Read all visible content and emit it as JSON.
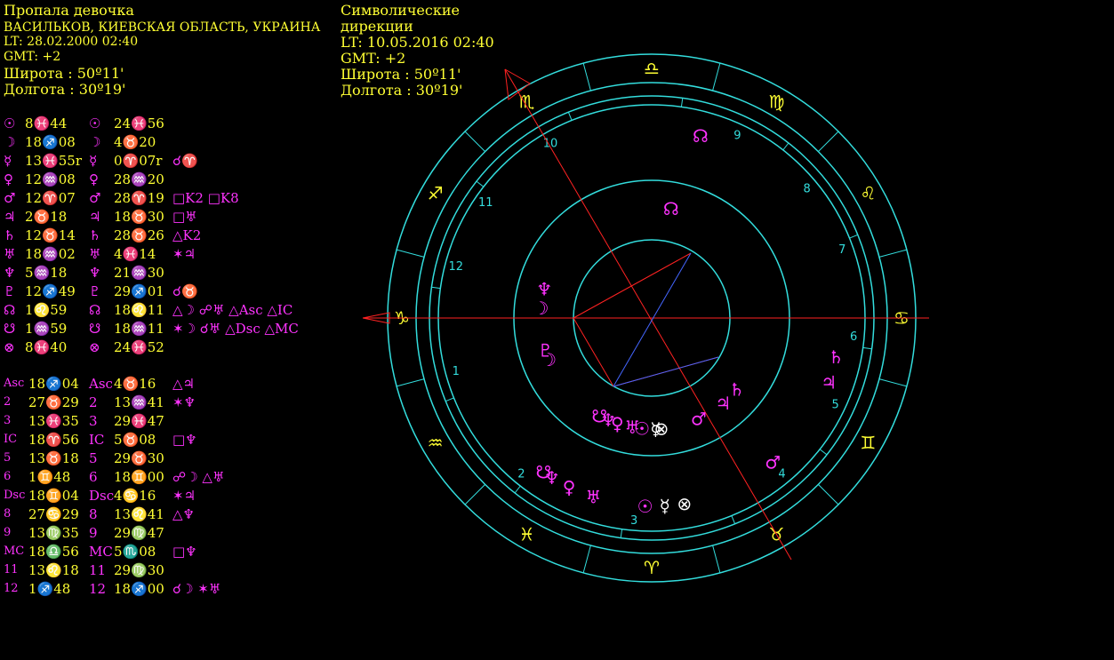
{
  "natal": {
    "title": "Пропала девочка",
    "place": "ВАСИЛЬКОВ, КИЕВСКАЯ ОБЛАСТЬ, УКРАИНА",
    "lt": "LT: 28.02.2000  02:40",
    "gmt": "GMT: +2",
    "lat": "Широта :      50º11'",
    "lon": "Долгота :      30º19'"
  },
  "directions": {
    "title_line1": "Символические",
    "title_line2": "дирекции",
    "lt": "LT: 10.05.2016  02:40",
    "gmt": "GMT: +2",
    "lat": "Широта :       50º11'",
    "lon": "Долгота :      30º19'"
  },
  "planets": [
    {
      "sym": "☉",
      "natal": "8♓44",
      "dsym": "☉",
      "dir": "24♓56",
      "aspects": ""
    },
    {
      "sym": "☽",
      "natal": "18♐08",
      "dsym": "☽",
      "dir": "4♉20",
      "aspects": ""
    },
    {
      "sym": "☿",
      "natal": "13♓55r",
      "dsym": "☿",
      "dir": "0♈07r",
      "aspects": "☌♈"
    },
    {
      "sym": "♀",
      "natal": "12♒08",
      "dsym": "♀",
      "dir": "28♒20",
      "aspects": ""
    },
    {
      "sym": "♂",
      "natal": "12♈07",
      "dsym": "♂",
      "dir": "28♈19",
      "aspects": "□K2 □K8"
    },
    {
      "sym": "♃",
      "natal": "2♉18",
      "dsym": "♃",
      "dir": "18♉30",
      "aspects": "□♅"
    },
    {
      "sym": "♄",
      "natal": "12♉14",
      "dsym": "♄",
      "dir": "28♉26",
      "aspects": "△K2"
    },
    {
      "sym": "♅",
      "natal": "18♒02",
      "dsym": "♅",
      "dir": "4♓14",
      "aspects": "✶♃"
    },
    {
      "sym": "♆",
      "natal": "5♒18",
      "dsym": "♆",
      "dir": "21♒30",
      "aspects": ""
    },
    {
      "sym": "♇",
      "natal": "12♐49",
      "dsym": "♇",
      "dir": "29♐01",
      "aspects": "☌♉"
    },
    {
      "sym": "☊",
      "natal": "1♌59",
      "dsym": "☊",
      "dir": "18♌11",
      "aspects": "△☽ ☍♅ △Asc △IC"
    },
    {
      "sym": "☋",
      "natal": "1♒59",
      "dsym": "☋",
      "dir": "18♒11",
      "aspects": "✶☽ ☌♅ △Dsc △MC"
    },
    {
      "sym": "⊗",
      "natal": "8♓40",
      "dsym": "⊗",
      "dir": "24♓52",
      "aspects": ""
    }
  ],
  "houses": [
    {
      "label": "Asc",
      "natal": "18♐04",
      "dlabel": "Asc",
      "dir": "4♉16",
      "aspects": "△♃"
    },
    {
      "label": "2",
      "natal": "27♉29",
      "dlabel": "2",
      "dir": "13♒41",
      "aspects": "✶♆"
    },
    {
      "label": "3",
      "natal": "13♓35",
      "dlabel": "3",
      "dir": "29♓47",
      "aspects": ""
    },
    {
      "label": "IC",
      "natal": "18♈56",
      "dlabel": "IC",
      "dir": "5♉08",
      "aspects": "□♆"
    },
    {
      "label": "5",
      "natal": "13♉18",
      "dlabel": "5",
      "dir": "29♉30",
      "aspects": ""
    },
    {
      "label": "6",
      "natal": "1♊48",
      "dlabel": "6",
      "dir": "18♊00",
      "aspects": "☍☽ △♅"
    },
    {
      "label": "Dsc",
      "natal": "18♊04",
      "dlabel": "Dsc",
      "dir": "4♋16",
      "aspects": "✶♃"
    },
    {
      "label": "8",
      "natal": "27♋29",
      "dlabel": "8",
      "dir": "13♌41",
      "aspects": "△♆"
    },
    {
      "label": "9",
      "natal": "13♍35",
      "dlabel": "9",
      "dir": "29♍47",
      "aspects": ""
    },
    {
      "label": "MC",
      "natal": "18♎56",
      "dlabel": "MC",
      "dir": "5♏08",
      "aspects": "□♆"
    },
    {
      "label": "11",
      "natal": "13♌18",
      "dlabel": "11",
      "dir": "29♍30",
      "aspects": ""
    },
    {
      "label": "12",
      "natal": "1♐48",
      "dlabel": "12",
      "dir": "18♐00",
      "aspects": "☌☽ ✶♅"
    }
  ],
  "wheel": {
    "zodiac": [
      {
        "sym": "♍",
        "deg": -60
      },
      {
        "sym": "♌",
        "deg": -30
      },
      {
        "sym": "♋",
        "deg": 0
      },
      {
        "sym": "♊",
        "deg": 30
      },
      {
        "sym": "♉",
        "deg": 60
      },
      {
        "sym": "♈",
        "deg": 90
      },
      {
        "sym": "♓",
        "deg": 120
      },
      {
        "sym": "♒",
        "deg": 150
      },
      {
        "sym": "♑",
        "deg": 180
      },
      {
        "sym": "♐",
        "deg": 210
      },
      {
        "sym": "♏",
        "deg": 240
      },
      {
        "sym": "♎",
        "deg": 270
      }
    ],
    "house_numbers": [
      {
        "n": "9",
        "deg": -65
      },
      {
        "n": "8",
        "deg": -40
      },
      {
        "n": "7",
        "deg": -20
      },
      {
        "n": "6",
        "deg": 5
      },
      {
        "n": "5",
        "deg": 25
      },
      {
        "n": "4",
        "deg": 50
      },
      {
        "n": "3",
        "deg": 95
      },
      {
        "n": "2",
        "deg": 130
      },
      {
        "n": "1",
        "deg": 165
      },
      {
        "n": "12",
        "deg": 195
      },
      {
        "n": "11",
        "deg": 215
      },
      {
        "n": "10",
        "deg": 240
      }
    ],
    "outer_planets": [
      {
        "sym": "☊",
        "deg": -75,
        "color": "#ff33ff"
      },
      {
        "sym": "♄",
        "deg": 12,
        "color": "#ff33ff"
      },
      {
        "sym": "♃",
        "deg": 20,
        "color": "#ff33ff"
      },
      {
        "sym": "♂",
        "deg": 50,
        "color": "#ff33ff"
      },
      {
        "sym": "⊗",
        "deg": 80,
        "color": "#ffffff"
      },
      {
        "sym": "☿",
        "deg": 86,
        "color": "#ffffff"
      },
      {
        "sym": "☉",
        "deg": 92,
        "color": "#ff33ff"
      },
      {
        "sym": "♅",
        "deg": 108,
        "color": "#ff33ff"
      },
      {
        "sym": "♀",
        "deg": 116,
        "color": "#ff33ff"
      },
      {
        "sym": "♆",
        "deg": 122,
        "color": "#ff33ff"
      },
      {
        "sym": "☋",
        "deg": 125,
        "color": "#ff33ff"
      }
    ],
    "inner_planets": [
      {
        "sym": "☊",
        "deg": -80,
        "color": "#ff33ff"
      },
      {
        "sym": "♄",
        "deg": 40,
        "color": "#ff33ff"
      },
      {
        "sym": "♃",
        "deg": 50,
        "color": "#ff33ff"
      },
      {
        "sym": "⊗",
        "deg": 85,
        "color": "#ffffff"
      },
      {
        "sym": "☿",
        "deg": 88,
        "color": "#ffffff"
      },
      {
        "sym": "♅",
        "deg": 100,
        "color": "#ff33ff"
      },
      {
        "sym": "♀",
        "deg": 108,
        "color": "#ff33ff"
      },
      {
        "sym": "♆",
        "deg": 113,
        "color": "#ff33ff"
      },
      {
        "sym": "☋",
        "deg": 118,
        "color": "#ff33ff"
      },
      {
        "sym": "♂",
        "deg": 65,
        "color": "#ff33ff"
      },
      {
        "sym": "☉",
        "deg": 95,
        "color": "#ff33ff"
      },
      {
        "sym": "☽",
        "deg": 158,
        "color": "#ff33ff"
      },
      {
        "sym": "♇",
        "deg": 163,
        "color": "#ff33ff"
      },
      {
        "sym": "♆",
        "deg": 195,
        "color": "#ff33ff"
      },
      {
        "sym": "☽",
        "deg": 185,
        "color": "#ff33ff"
      }
    ],
    "colors": {
      "ring": "#33dddd",
      "zodiac": "#ffff33",
      "axis": "#ff2222",
      "blue": "#4466ff"
    }
  }
}
